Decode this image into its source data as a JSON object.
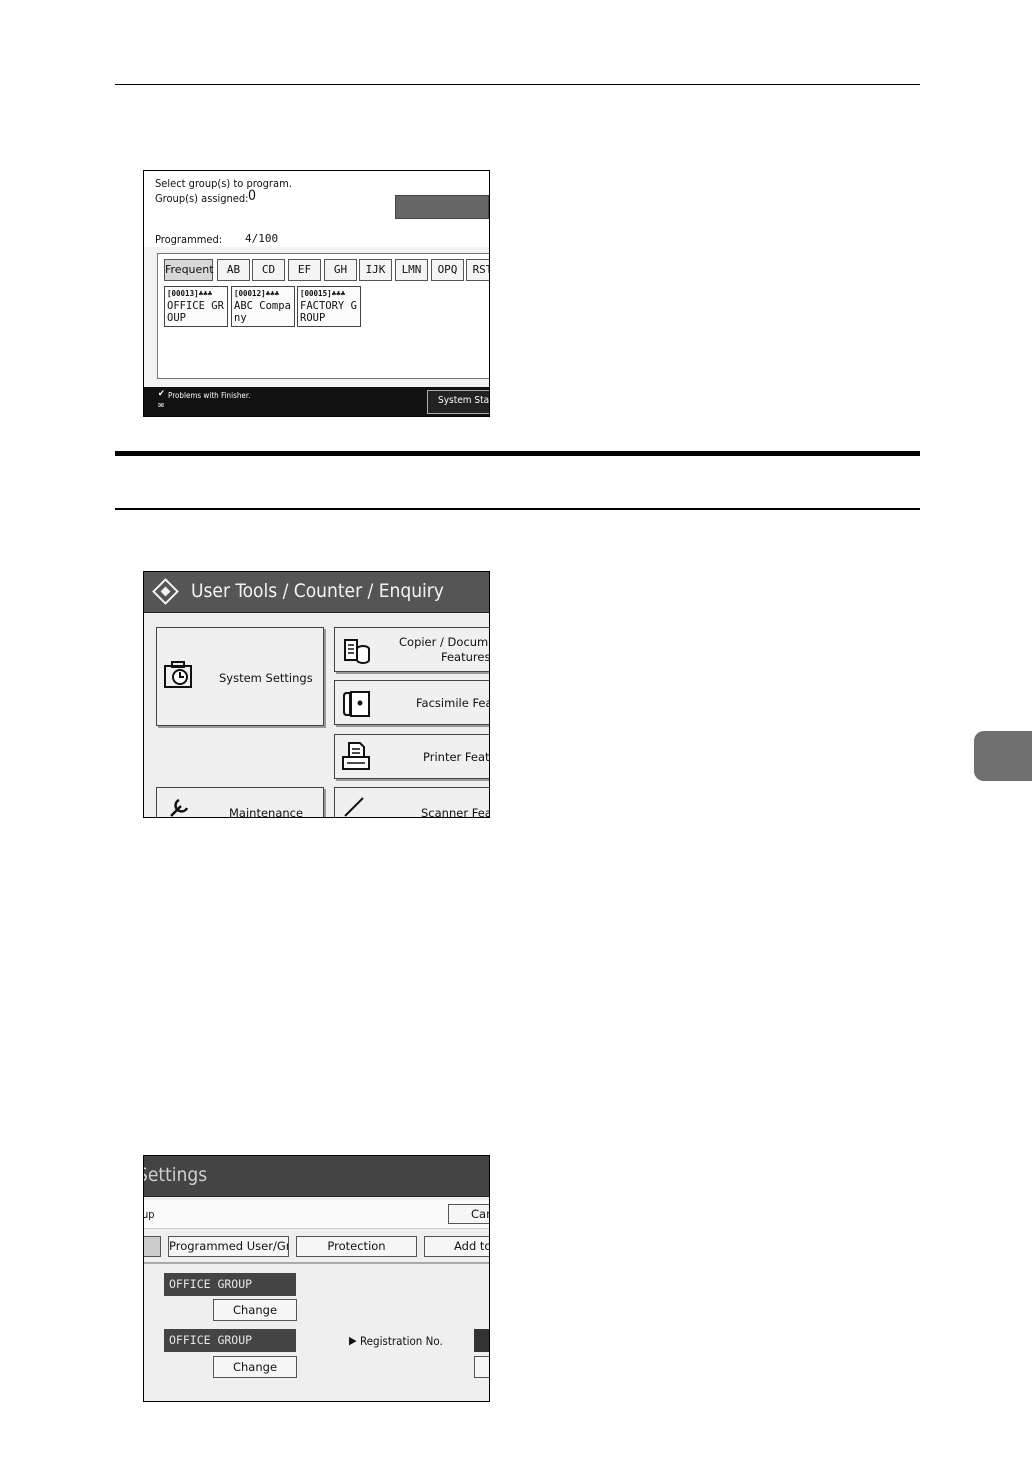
{
  "shot1": {
    "line1": "Select group(s) to program.",
    "assigned_label": "Group(s) assigned:",
    "assigned_value": "0",
    "programmed_label": "Programmed:",
    "programmed_value": "4/100",
    "tabs": [
      "Frequent",
      "AB",
      "CD",
      "EF",
      "GH",
      "IJK",
      "LMN",
      "OPQ",
      "RST"
    ],
    "destinations": [
      {
        "reg": "[00013]",
        "name": "OFFICE GROUP"
      },
      {
        "reg": "[00012]",
        "name": "ABC Company"
      },
      {
        "reg": "[00015]",
        "name": "FACTORY GROUP"
      }
    ],
    "status_message": "Problems with Finisher.",
    "system_status_button": "System Status"
  },
  "shot2": {
    "title": "User Tools / Counter / Enquiry",
    "system_settings": "System Settings",
    "copier_line1": "Copier / Document",
    "copier_line2": "Features",
    "facsimile": "Facsimile Features",
    "printer": "Printer Features",
    "maintenance": "Maintenance",
    "scanner": "Scanner Features"
  },
  "shot3": {
    "title": "Settings",
    "breadcrumb": "up",
    "cancel": "Cancel",
    "tab_programmed": "Programmed User/Group",
    "tab_protection": "Protection",
    "tab_add": "Add to",
    "group_name_1": "OFFICE GROUP",
    "change_1": "Change",
    "group_name_2": "OFFICE GROUP",
    "change_2": "Change",
    "registration_label": "Registration No."
  }
}
